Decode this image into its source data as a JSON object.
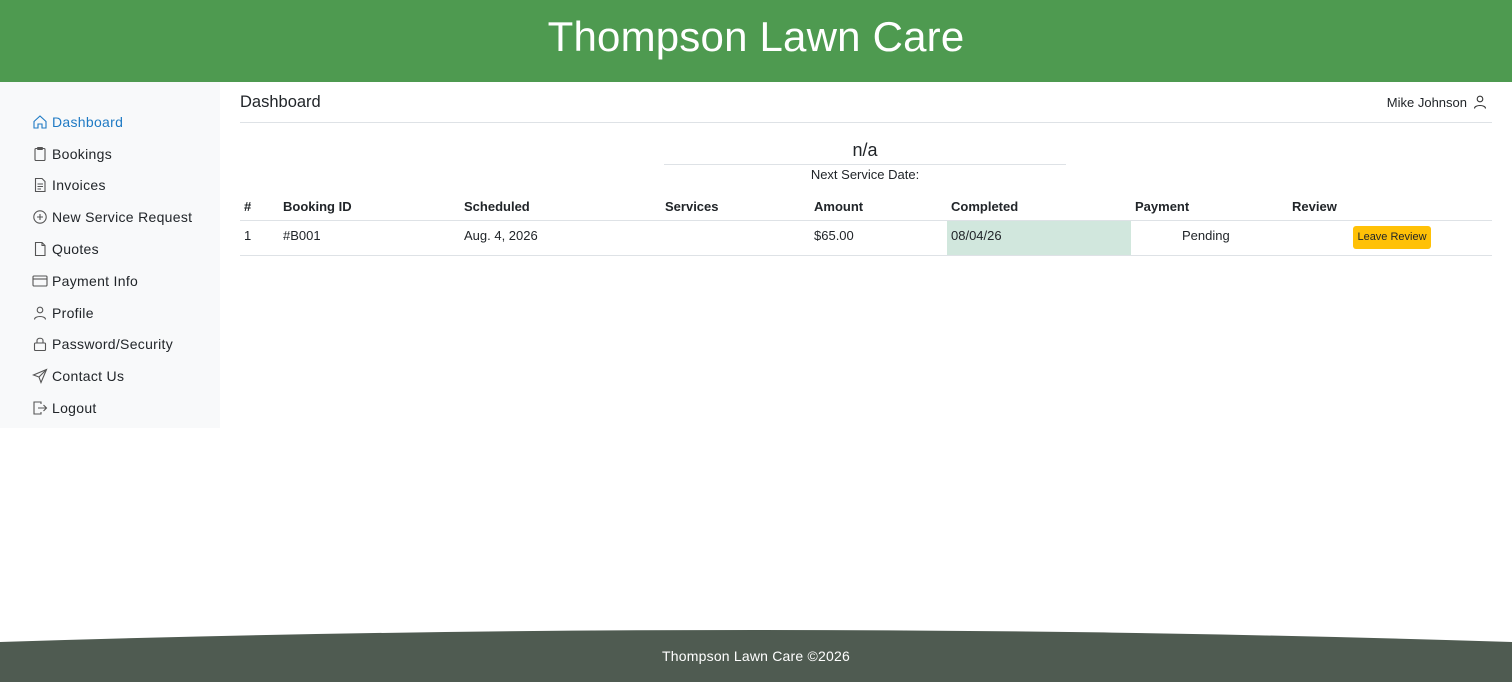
{
  "header": {
    "title": "Thompson Lawn Care"
  },
  "sidebar": {
    "items": [
      {
        "label": "Dashboard",
        "icon": "house-icon",
        "active": true
      },
      {
        "label": "Bookings",
        "icon": "clipboard-icon"
      },
      {
        "label": "Invoices",
        "icon": "file-text-icon"
      },
      {
        "label": "New Service Request",
        "icon": "plus-circle-icon"
      },
      {
        "label": "Quotes",
        "icon": "file-icon"
      },
      {
        "label": "Payment Info",
        "icon": "credit-card-icon"
      },
      {
        "label": "Profile",
        "icon": "person-icon"
      },
      {
        "label": "Password/Security",
        "icon": "lock-icon"
      },
      {
        "label": "Contact Us",
        "icon": "send-icon"
      },
      {
        "label": "Logout",
        "icon": "box-arrow-right-icon"
      }
    ]
  },
  "main": {
    "heading": "Dashboard",
    "user_name": "Mike Johnson",
    "next_service": {
      "value": "n/a",
      "label": "Next Service Date:"
    },
    "table": {
      "headers": [
        "#",
        "Booking ID",
        "Scheduled",
        "Services",
        "Amount",
        "Completed",
        "Payment",
        "Review"
      ],
      "rows": [
        {
          "num": "1",
          "booking_id": "#B001",
          "scheduled": "Aug. 4, 2026",
          "services": "",
          "amount": "$65.00",
          "completed": "08/04/26",
          "payment": "Pending",
          "review_button": "Leave Review"
        }
      ]
    }
  },
  "footer": {
    "text": "Thompson Lawn Care ©2026"
  },
  "colors": {
    "header_bg": "#4e9a50",
    "footer_bg": "#4f5b51",
    "active_link": "#1f7ac4",
    "completed_cell": "#d1e7dd",
    "review_button": "#ffc107"
  }
}
